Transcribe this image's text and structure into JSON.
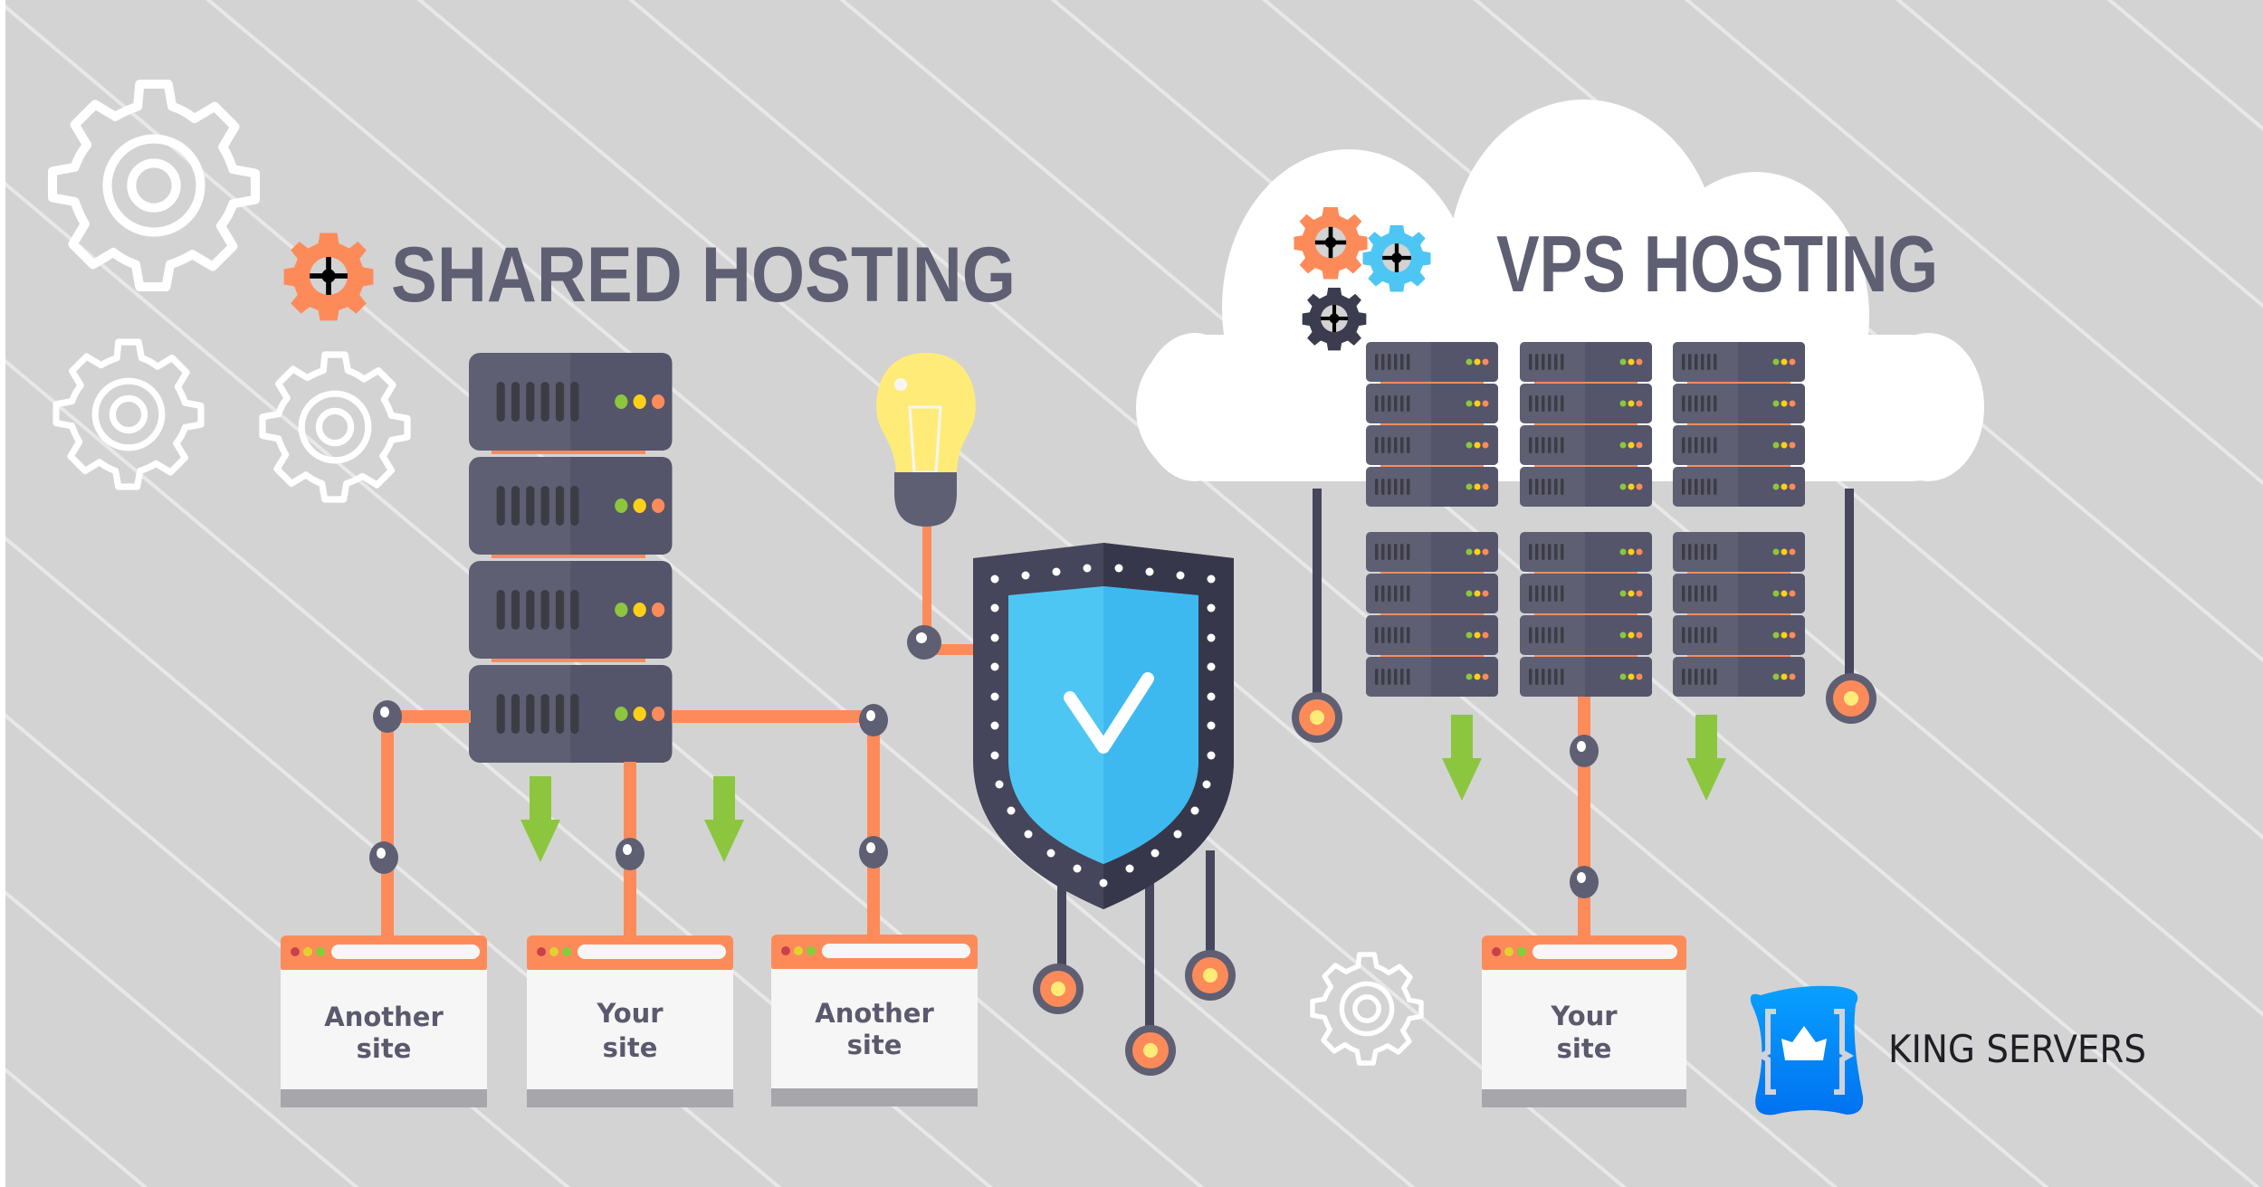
{
  "shared": {
    "title": "SHARED HOSTING",
    "sites": [
      {
        "line1": "Another",
        "line2": "site"
      },
      {
        "line1": "Your",
        "line2": "site"
      },
      {
        "line1": "Another",
        "line2": "site"
      }
    ],
    "server_units": 4
  },
  "vps": {
    "title": "VPS HOSTING",
    "rack_columns": 3,
    "units_per_rack": 4,
    "rack_rows": 2,
    "site": {
      "line1": "Your",
      "line2": "site"
    }
  },
  "brand": {
    "name": "KING SERVERS",
    "logo_icon": "crown-bracket-logo"
  },
  "icons": {
    "gear": "gear-icon",
    "bulb": "lightbulb-icon",
    "shield": "shield-check-icon",
    "arrow": "arrow-down-icon"
  },
  "colors": {
    "background": "#d3d3d3",
    "stripe": "#e6e6e6",
    "server_dark": "#54546a",
    "server_light": "#5f5f73",
    "vent": "#3c3c44",
    "wire_orange": "#fd8b5a",
    "led_green": "#8cc63e",
    "led_yellow": "#fdd017",
    "led_orange": "#fd8b5a",
    "arrow_green": "#8cc63e",
    "shield_blue": "#4ec6f4",
    "shield_frame": "#3d3d52",
    "bulb_yellow": "#ffec78",
    "gear_orange": "#fd8b5a",
    "gear_blue": "#4ec6f4",
    "gear_dark": "#3c3c50",
    "brand_blue": "#0a8cff",
    "text_dark": "#5f5f73"
  }
}
